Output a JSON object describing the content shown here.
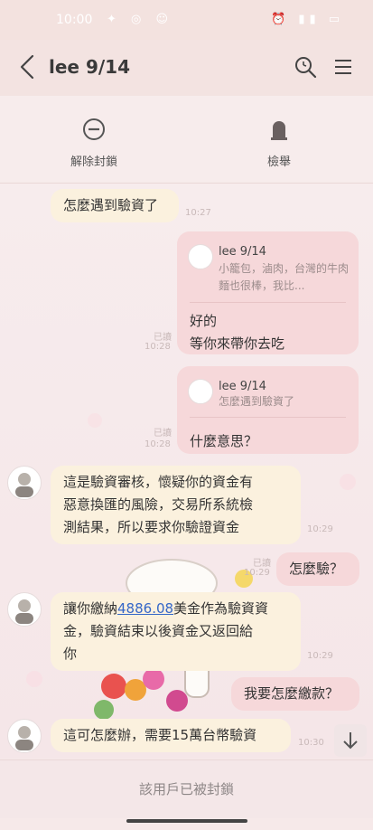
{
  "status": {
    "time": "10:00",
    "left_icons": "✦ ◎ ☺",
    "right_icons": "⏰ ▮▮ ▭"
  },
  "header": {
    "title": "lee 9/14"
  },
  "actions": [
    {
      "label": "解除封鎖"
    },
    {
      "label": "檢舉"
    }
  ],
  "messages": [
    {
      "text": "怎麼遇到驗資了",
      "time": "10:27"
    },
    {
      "reply_name": "lee 9/14",
      "reply_text": "小籠包，滷肉，台灣的牛肉麵也很棒，我比...",
      "text_line1": "好的",
      "text_line2": "等你來帶你去吃",
      "read": "已讀",
      "time": "10:28"
    },
    {
      "reply_name": "lee 9/14",
      "reply_text": "怎麼遇到驗資了",
      "text": "什麼意思？",
      "read": "已讀",
      "time": "10:28"
    },
    {
      "line1": "這是驗資審核，懷疑你的資金有",
      "line2": "惡意換匯的風險，交易所系統檢",
      "line3": "測結果，所以要求你驗證資金",
      "time": "10:29"
    },
    {
      "text": "怎麼驗？",
      "read": "已讀",
      "time": "10:29"
    },
    {
      "line1_pre": "讓你繳納",
      "line1_link": "4886.08",
      "line1_post": "美金作為驗資資",
      "line2": "金，驗資結束以後資金又返回給",
      "line3": "你",
      "time": "10:29"
    },
    {
      "text": "我要怎麼繳款？"
    },
    {
      "text": "這可怎麼辦，需要15萬台幣驗資",
      "time": "10:30"
    }
  ],
  "footer": {
    "text": "該用戶已被封鎖"
  },
  "colors": {
    "incoming_bubble": "#fbf1de",
    "outgoing_bubble": "#f6d8da",
    "link": "#3567c8"
  },
  "icons": [
    "back-arrow-icon",
    "search-icon",
    "menu-icon",
    "unblock-icon",
    "report-icon",
    "scroll-down-icon"
  ]
}
